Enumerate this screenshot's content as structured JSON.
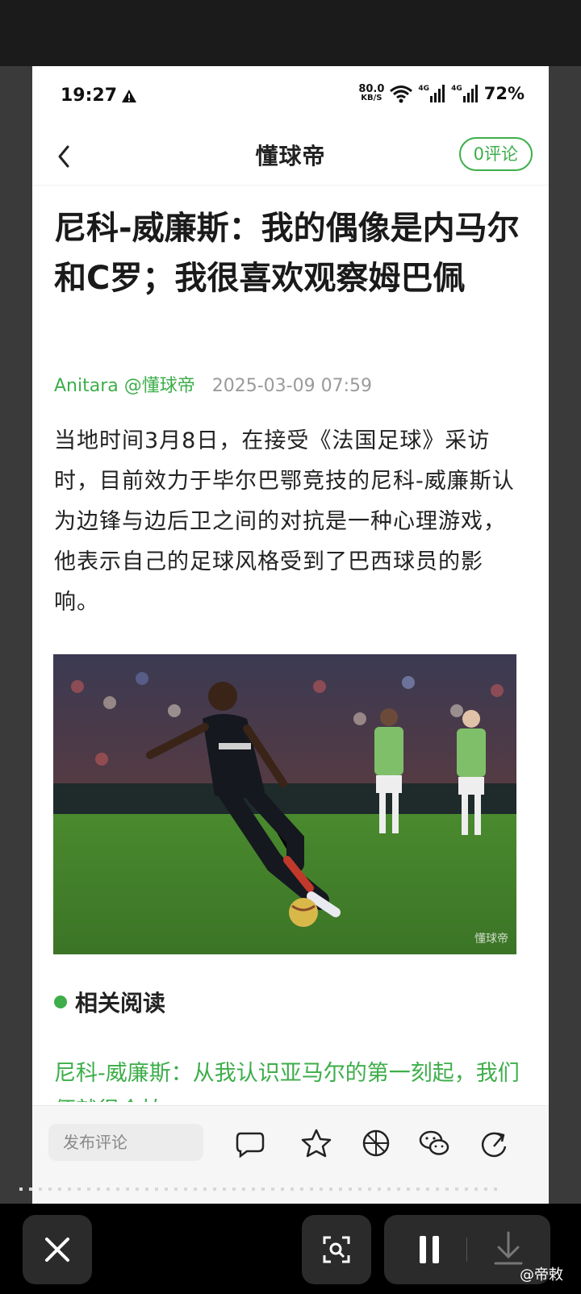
{
  "status": {
    "time": "19:27",
    "net_speed_value": "80.0",
    "net_speed_unit": "KB/S",
    "net1": "4G",
    "net2": "4G",
    "battery": "72%"
  },
  "appbar": {
    "title": "懂球帝",
    "comments": "0评论"
  },
  "article": {
    "headline": "尼科-威廉斯：我的偶像是内马尔和C罗；我很喜欢观察姆巴佩",
    "author": "Anitara @懂球帝",
    "date": "2025-03-09 07:59",
    "body": "当地时间3月8日，在接受《法国足球》采访时，目前效力于毕尔巴鄂竞技的尼科-威廉斯认为边锋与边后卫之间的对抗是一种心理游戏，他表示自己的足球风格受到了巴西球员的影响。",
    "image_watermark": "懂球帝"
  },
  "related": {
    "label": "相关阅读",
    "items": [
      "尼科-威廉斯：从我认识亚马尔的第一刻起，我们便就很合拍"
    ]
  },
  "bottombar": {
    "comment_placeholder": "发布评论"
  },
  "footer": {
    "weibo_handle": "@帝敕"
  },
  "colors": {
    "accent": "#3dae4a"
  }
}
